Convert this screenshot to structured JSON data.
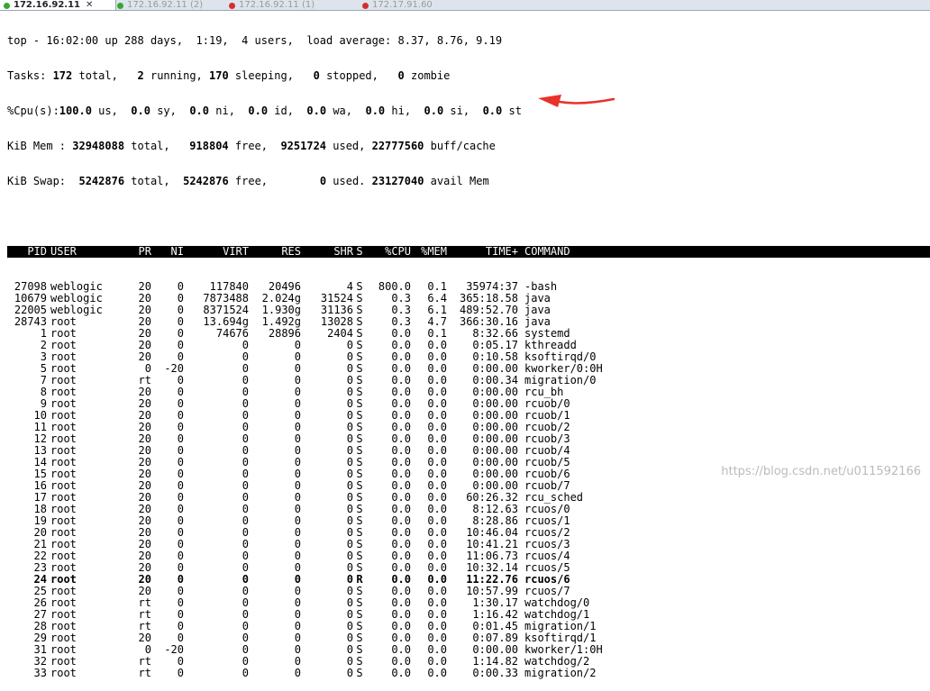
{
  "tabs": [
    {
      "label": "172.16.92.11",
      "close": "✕",
      "active": true,
      "status_color": "#33a833"
    },
    {
      "label": "172.16.92.11 (2)",
      "active": false,
      "status_color": "#33a833"
    },
    {
      "label": "172.16.92.11 (1)",
      "active": false,
      "status_color": "#d62d2d"
    },
    {
      "label": "172.17.91.60",
      "active": false,
      "status_color": "#d62d2d"
    }
  ],
  "summary": {
    "line1": {
      "t0": "top - 16:02:00 up 288 days,  1:19,  4 users,  load average: 8.37, 8.76, 9.19"
    },
    "line2": {
      "t0": "Tasks: ",
      "b0": "172",
      "t1": " total,   ",
      "b1": "2",
      "t2": " running, ",
      "b2": "170",
      "t3": " sleeping,   ",
      "b3": "0",
      "t4": " stopped,   ",
      "b4": "0",
      "t5": " zombie"
    },
    "line3": {
      "t0": "%Cpu(s):",
      "b0": "100.0",
      "t1": " us,  ",
      "b1": "0.0",
      "t2": " sy,  ",
      "b2": "0.0",
      "t3": " ni,  ",
      "b3": "0.0",
      "t4": " id,  ",
      "b4": "0.0",
      "t5": " wa,  ",
      "b5": "0.0",
      "t6": " hi,  ",
      "b6": "0.0",
      "t7": " si,  ",
      "b7": "0.0",
      "t8": " st"
    },
    "line4": {
      "t0": "KiB Mem : ",
      "b0": "32948088",
      "t1": " total,   ",
      "b1": "918804",
      "t2": " free,  ",
      "b2": "9251724",
      "t3": " used, ",
      "b3": "22777560",
      "t4": " buff/cache"
    },
    "line5": {
      "t0": "KiB Swap:  ",
      "b0": "5242876",
      "t1": " total,  ",
      "b1": "5242876",
      "t2": " free,        ",
      "b2": "0",
      "t3": " used. ",
      "b3": "23127040",
      "t4": " avail Mem"
    }
  },
  "table": {
    "headers": {
      "pid": "PID",
      "user": "USER",
      "pr": "PR",
      "ni": "NI",
      "virt": "VIRT",
      "res": "RES",
      "shr": "SHR",
      "s": "S",
      "cpu": "%CPU",
      "mem": "%MEM",
      "time": "TIME+",
      "command": "COMMAND"
    },
    "rows": [
      [
        "27098",
        "weblogic",
        "20",
        "0",
        "117840",
        "20496",
        "4",
        "S",
        "800.0",
        "0.1",
        "35974:37",
        "-bash"
      ],
      [
        "10679",
        "weblogic",
        "20",
        "0",
        "7873488",
        "2.024g",
        "31524",
        "S",
        "0.3",
        "6.4",
        "365:18.58",
        "java"
      ],
      [
        "22005",
        "weblogic",
        "20",
        "0",
        "8371524",
        "1.930g",
        "31136",
        "S",
        "0.3",
        "6.1",
        "489:52.70",
        "java"
      ],
      [
        "28743",
        "root",
        "20",
        "0",
        "13.694g",
        "1.492g",
        "13028",
        "S",
        "0.3",
        "4.7",
        "366:30.16",
        "java"
      ],
      [
        "1",
        "root",
        "20",
        "0",
        "74676",
        "28896",
        "2404",
        "S",
        "0.0",
        "0.1",
        "8:32.66",
        "systemd"
      ],
      [
        "2",
        "root",
        "20",
        "0",
        "0",
        "0",
        "0",
        "S",
        "0.0",
        "0.0",
        "0:05.17",
        "kthreadd"
      ],
      [
        "3",
        "root",
        "20",
        "0",
        "0",
        "0",
        "0",
        "S",
        "0.0",
        "0.0",
        "0:10.58",
        "ksoftirqd/0"
      ],
      [
        "5",
        "root",
        "0",
        "-20",
        "0",
        "0",
        "0",
        "S",
        "0.0",
        "0.0",
        "0:00.00",
        "kworker/0:0H"
      ],
      [
        "7",
        "root",
        "rt",
        "0",
        "0",
        "0",
        "0",
        "S",
        "0.0",
        "0.0",
        "0:00.34",
        "migration/0"
      ],
      [
        "8",
        "root",
        "20",
        "0",
        "0",
        "0",
        "0",
        "S",
        "0.0",
        "0.0",
        "0:00.00",
        "rcu_bh"
      ],
      [
        "9",
        "root",
        "20",
        "0",
        "0",
        "0",
        "0",
        "S",
        "0.0",
        "0.0",
        "0:00.00",
        "rcuob/0"
      ],
      [
        "10",
        "root",
        "20",
        "0",
        "0",
        "0",
        "0",
        "S",
        "0.0",
        "0.0",
        "0:00.00",
        "rcuob/1"
      ],
      [
        "11",
        "root",
        "20",
        "0",
        "0",
        "0",
        "0",
        "S",
        "0.0",
        "0.0",
        "0:00.00",
        "rcuob/2"
      ],
      [
        "12",
        "root",
        "20",
        "0",
        "0",
        "0",
        "0",
        "S",
        "0.0",
        "0.0",
        "0:00.00",
        "rcuob/3"
      ],
      [
        "13",
        "root",
        "20",
        "0",
        "0",
        "0",
        "0",
        "S",
        "0.0",
        "0.0",
        "0:00.00",
        "rcuob/4"
      ],
      [
        "14",
        "root",
        "20",
        "0",
        "0",
        "0",
        "0",
        "S",
        "0.0",
        "0.0",
        "0:00.00",
        "rcuob/5"
      ],
      [
        "15",
        "root",
        "20",
        "0",
        "0",
        "0",
        "0",
        "S",
        "0.0",
        "0.0",
        "0:00.00",
        "rcuob/6"
      ],
      [
        "16",
        "root",
        "20",
        "0",
        "0",
        "0",
        "0",
        "S",
        "0.0",
        "0.0",
        "0:00.00",
        "rcuob/7"
      ],
      [
        "17",
        "root",
        "20",
        "0",
        "0",
        "0",
        "0",
        "S",
        "0.0",
        "0.0",
        "60:26.32",
        "rcu_sched"
      ],
      [
        "18",
        "root",
        "20",
        "0",
        "0",
        "0",
        "0",
        "S",
        "0.0",
        "0.0",
        "8:12.63",
        "rcuos/0"
      ],
      [
        "19",
        "root",
        "20",
        "0",
        "0",
        "0",
        "0",
        "S",
        "0.0",
        "0.0",
        "8:28.86",
        "rcuos/1"
      ],
      [
        "20",
        "root",
        "20",
        "0",
        "0",
        "0",
        "0",
        "S",
        "0.0",
        "0.0",
        "10:46.04",
        "rcuos/2"
      ],
      [
        "21",
        "root",
        "20",
        "0",
        "0",
        "0",
        "0",
        "S",
        "0.0",
        "0.0",
        "10:41.21",
        "rcuos/3"
      ],
      [
        "22",
        "root",
        "20",
        "0",
        "0",
        "0",
        "0",
        "S",
        "0.0",
        "0.0",
        "11:06.73",
        "rcuos/4"
      ],
      [
        "23",
        "root",
        "20",
        "0",
        "0",
        "0",
        "0",
        "S",
        "0.0",
        "0.0",
        "10:32.14",
        "rcuos/5"
      ],
      [
        "24",
        "root",
        "20",
        "0",
        "0",
        "0",
        "0",
        "R",
        "0.0",
        "0.0",
        "11:22.76",
        "rcuos/6"
      ],
      [
        "25",
        "root",
        "20",
        "0",
        "0",
        "0",
        "0",
        "S",
        "0.0",
        "0.0",
        "10:57.99",
        "rcuos/7"
      ],
      [
        "26",
        "root",
        "rt",
        "0",
        "0",
        "0",
        "0",
        "S",
        "0.0",
        "0.0",
        "1:30.17",
        "watchdog/0"
      ],
      [
        "27",
        "root",
        "rt",
        "0",
        "0",
        "0",
        "0",
        "S",
        "0.0",
        "0.0",
        "1:16.42",
        "watchdog/1"
      ],
      [
        "28",
        "root",
        "rt",
        "0",
        "0",
        "0",
        "0",
        "S",
        "0.0",
        "0.0",
        "0:01.45",
        "migration/1"
      ],
      [
        "29",
        "root",
        "20",
        "0",
        "0",
        "0",
        "0",
        "S",
        "0.0",
        "0.0",
        "0:07.89",
        "ksoftirqd/1"
      ],
      [
        "31",
        "root",
        "0",
        "-20",
        "0",
        "0",
        "0",
        "S",
        "0.0",
        "0.0",
        "0:00.00",
        "kworker/1:0H"
      ],
      [
        "32",
        "root",
        "rt",
        "0",
        "0",
        "0",
        "0",
        "S",
        "0.0",
        "0.0",
        "1:14.82",
        "watchdog/2"
      ],
      [
        "33",
        "root",
        "rt",
        "0",
        "0",
        "0",
        "0",
        "S",
        "0.0",
        "0.0",
        "0:00.33",
        "migration/2"
      ]
    ],
    "running_row_index": 25
  },
  "annotation": {
    "arrow_color": "#e8322b",
    "arrow_icon": "red-arrow-icon"
  },
  "watermark": "https://blog.csdn.net/u011592166"
}
